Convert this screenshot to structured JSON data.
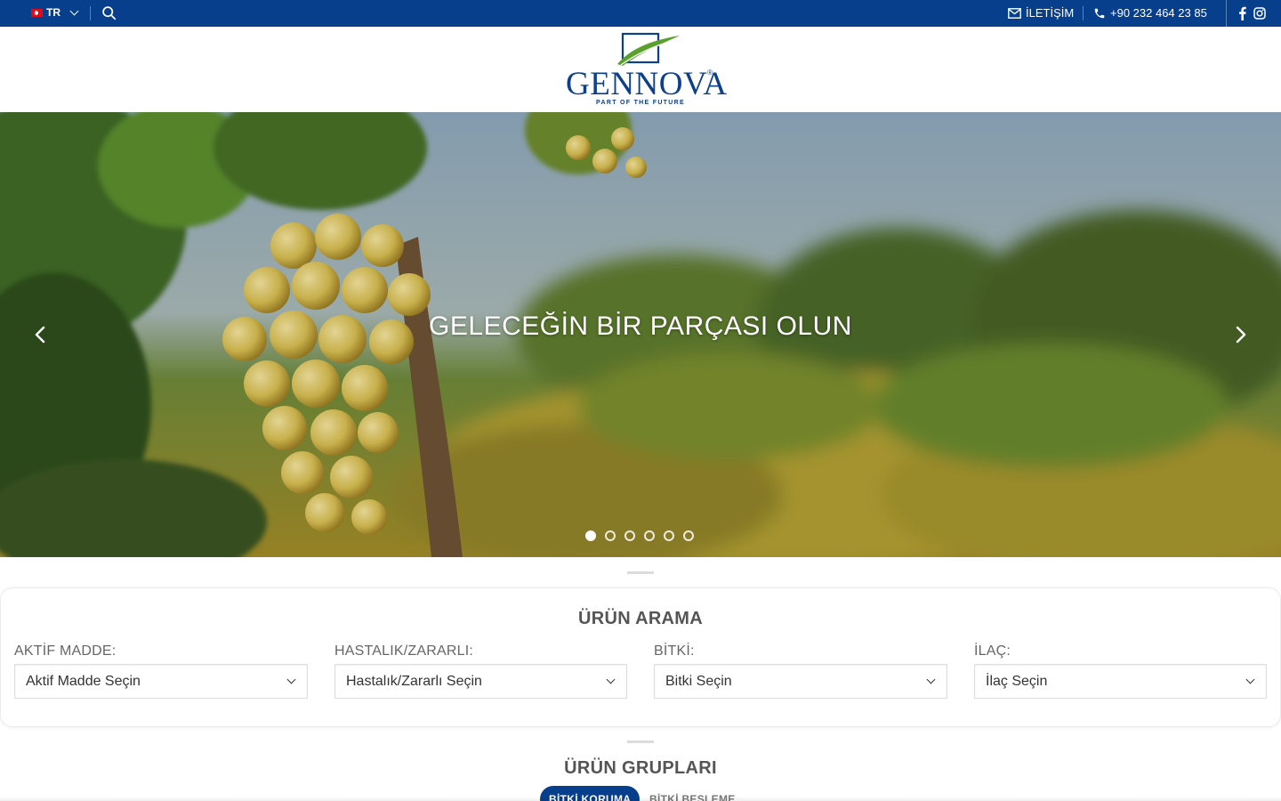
{
  "colors": {
    "brand": "#073f8c",
    "topbar_bg": "#073f8c",
    "logo_leaf": "#5aa02c"
  },
  "topbar": {
    "language": "TR",
    "contact_label": "İLETİŞİM",
    "phone": "+90 232 464 23 85",
    "icons": [
      "turkey-flag-icon",
      "chevron-down-icon",
      "search-icon",
      "mail-icon",
      "phone-icon",
      "facebook-icon",
      "instagram-icon"
    ]
  },
  "header": {
    "logo_text": "GENNOVA",
    "logo_reg": "®",
    "logo_tagline": "PART OF THE FUTURE"
  },
  "hero": {
    "title": "GELECEĞİN BİR  PARÇASI OLUN",
    "slide_count": 6,
    "active_slide": 1
  },
  "product_search": {
    "title": "ÜRÜN ARAMA",
    "fields": [
      {
        "label": "AKTİF MADDE:",
        "value": "Aktif Madde Seçin"
      },
      {
        "label": "HASTALIK/ZARARLI:",
        "value": "Hastalık/Zararlı Seçin"
      },
      {
        "label": "BİTKİ:",
        "value": "Bitki Seçin"
      },
      {
        "label": "İLAÇ:",
        "value": "İlaç Seçin"
      }
    ]
  },
  "product_groups": {
    "title": "ÜRÜN GRUPLARI",
    "tabs": [
      {
        "label": "BİTKİ KORUMA",
        "active": true
      },
      {
        "label": "BİTKİ BESLEME",
        "active": false
      }
    ]
  }
}
